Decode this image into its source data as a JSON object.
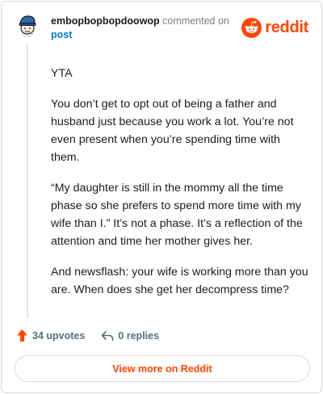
{
  "header": {
    "author": "embopbopbopdoowop",
    "action_text": "commented on",
    "post_link": "post"
  },
  "brand": {
    "wordmark": "reddit",
    "color": "#ff4500",
    "icon": "reddit-logo-icon"
  },
  "comment": {
    "paragraphs": [
      "YTA",
      "You don’t get to opt out of being a father and husband just because you work a lot. You’re not even present when you’re spending time with them.",
      "“My daughter is still in the mommy all the time phase so she prefers to spend more time with my wife than I.” It’s not a phase. It’s a reflection of the attention and time her mother gives her.",
      "And newsflash: your wife is working more than you are. When does she get her decompress time?"
    ]
  },
  "footer": {
    "upvotes": "34 upvotes",
    "upvote_icon": "upvote-arrow-icon",
    "upvote_color": "#ff4500",
    "replies": "0 replies",
    "reply_icon": "reply-arrow-icon",
    "view_more": "View more on Reddit"
  }
}
